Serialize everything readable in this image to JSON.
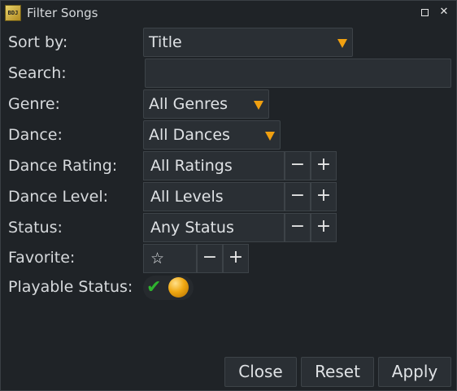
{
  "window": {
    "title": "Filter Songs",
    "app_icon_text": "BDJ",
    "maximize_glyph": "",
    "close_glyph": "✕"
  },
  "form": {
    "sort_by": {
      "label": "Sort by:",
      "value": "Title"
    },
    "search": {
      "label": "Search:",
      "value": ""
    },
    "genre": {
      "label": "Genre:",
      "value": "All Genres"
    },
    "dance": {
      "label": "Dance:",
      "value": "All Dances"
    },
    "dance_rating": {
      "label": "Dance Rating:",
      "value": "All Ratings"
    },
    "dance_level": {
      "label": "Dance Level:",
      "value": "All Levels"
    },
    "status": {
      "label": "Status:",
      "value": "Any Status"
    },
    "favorite": {
      "label": "Favorite:",
      "value": "☆"
    },
    "playable_status": {
      "label": "Playable Status:",
      "check_glyph": "✔"
    }
  },
  "spin": {
    "minus": "−",
    "plus": "+"
  },
  "buttons": {
    "close": "Close",
    "reset": "Reset",
    "apply": "Apply"
  },
  "colors": {
    "accent": "#f0a010",
    "check": "#2fb32f"
  },
  "icons": [
    "app-icon",
    "maximize-icon",
    "close-icon",
    "dropdown-arrow-icon",
    "check-icon",
    "orb-icon",
    "star-icon"
  ]
}
